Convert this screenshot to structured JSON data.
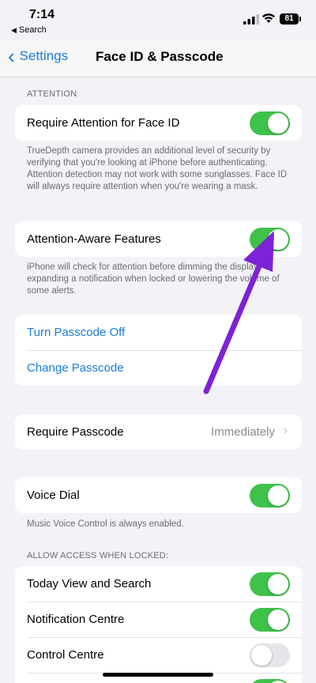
{
  "status_bar": {
    "time": "7:14",
    "back_app": "Search",
    "battery": "81"
  },
  "nav": {
    "back_label": "Settings",
    "title": "Face ID & Passcode"
  },
  "attention": {
    "header": "ATTENTION",
    "require_attention": {
      "label": "Require Attention for Face ID",
      "on": true
    },
    "require_attention_footer": "TrueDepth camera provides an additional level of security by verifying that you're looking at iPhone before authenticating. Attention detection may not work with some sunglasses. Face ID will always require attention when you're wearing a mask.",
    "aware_features": {
      "label": "Attention-Aware Features",
      "on": true
    },
    "aware_footer": "iPhone will check for attention before dimming the display, expanding a notification when locked or lowering the volume of some alerts."
  },
  "passcode": {
    "turn_off": "Turn Passcode Off",
    "change": "Change Passcode",
    "require_label": "Require Passcode",
    "require_value": "Immediately"
  },
  "voice_dial": {
    "label": "Voice Dial",
    "on": true,
    "footer": "Music Voice Control is always enabled."
  },
  "locked_access": {
    "header": "ALLOW ACCESS WHEN LOCKED:",
    "items": [
      {
        "label": "Today View and Search",
        "on": true
      },
      {
        "label": "Notification Centre",
        "on": true
      },
      {
        "label": "Control Centre",
        "on": false
      }
    ]
  },
  "colors": {
    "accent": "#1a7cd8",
    "toggle_on": "#3ec24a",
    "arrow": "#7d22d6"
  }
}
